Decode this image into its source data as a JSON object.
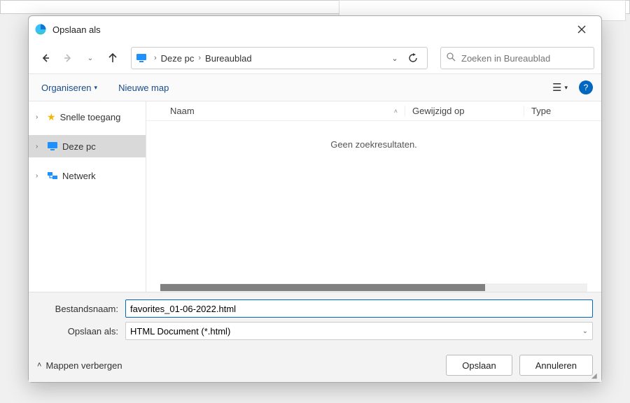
{
  "title": "Opslaan als",
  "nav": {
    "path_root": "Deze pc",
    "path_leaf": "Bureaublad",
    "search_placeholder": "Zoeken in Bureaublad"
  },
  "toolbar": {
    "organize": "Organiseren",
    "new_folder": "Nieuwe map"
  },
  "tree": {
    "quick": "Snelle toegang",
    "thispc": "Deze pc",
    "network": "Netwerk"
  },
  "columns": {
    "name": "Naam",
    "modified": "Gewijzigd op",
    "type": "Type"
  },
  "list": {
    "empty": "Geen zoekresultaten."
  },
  "fields": {
    "filename_label": "Bestandsnaam:",
    "filename_value": "favorites_01-06-2022.html",
    "filetype_label": "Opslaan als:",
    "filetype_value": "HTML Document (*.html)"
  },
  "footer": {
    "hide_folders": "Mappen verbergen",
    "save": "Opslaan",
    "cancel": "Annuleren"
  }
}
